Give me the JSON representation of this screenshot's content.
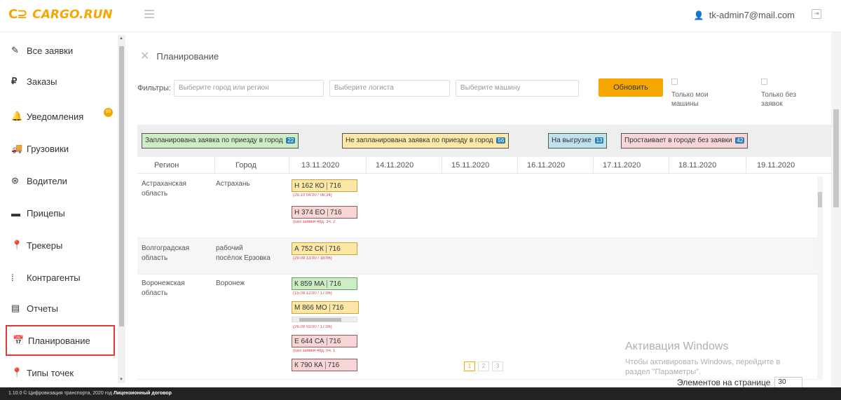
{
  "header": {
    "logo_mark": "C⊇",
    "logo_text": "CARGO.RUN",
    "user_email": "tk-admin7@mail.com"
  },
  "sidebar": {
    "items": [
      {
        "label": "Все заявки",
        "icon": "edit-icon"
      },
      {
        "label": "Заказы",
        "icon": "ruble-icon"
      },
      {
        "label": "Уведомления",
        "icon": "bell-icon",
        "badge": "99"
      },
      {
        "label": "Грузовики",
        "icon": "truck-icon"
      },
      {
        "label": "Водители",
        "icon": "steering-wheel-icon"
      },
      {
        "label": "Прицепы",
        "icon": "trailer-icon"
      },
      {
        "label": "Трекеры",
        "icon": "map-marker-icon"
      },
      {
        "label": "Контрагенты",
        "icon": "contractor-icon"
      },
      {
        "label": "Отчеты",
        "icon": "report-icon"
      },
      {
        "label": "Планирование",
        "icon": "calendar-icon",
        "active": true
      },
      {
        "label": "Типы точек",
        "icon": "map-marker-icon"
      }
    ]
  },
  "page": {
    "title": "Планирование",
    "filters_label": "Фильтры:",
    "city_placeholder": "Выберите город или регион",
    "logist_placeholder": "Выберите логиста",
    "car_placeholder": "Выберите машину",
    "update_button": "Обновить",
    "only_my_line1": "Только мои",
    "only_my_line2": "машины",
    "only_no_orders_line1": "Только без",
    "only_no_orders_line2": "заявок"
  },
  "legend": [
    {
      "label": "Запланирована заявка по приезду в город",
      "count": "22",
      "color": "#cdeec5"
    },
    {
      "label": "Не запланирована заявка по приезду в город",
      "count": "56",
      "color": "#fde8a8"
    },
    {
      "label": "На выгрузке",
      "count": "13",
      "color": "#bfe3ee"
    },
    {
      "label": "Простаивает в городе без заявки",
      "count": "42",
      "color": "#f9d6d6"
    }
  ],
  "table": {
    "headers": [
      "Регион",
      "Город",
      "13.11.2020",
      "14.11.2020",
      "15.11.2020",
      "16.11.2020",
      "17.11.2020",
      "18.11.2020",
      "19.11.2020"
    ],
    "rows": [
      {
        "region_l1": "Астраханская",
        "region_l2": "область",
        "city_l1": "Астрахань",
        "city_l2": "",
        "trucks": [
          {
            "plate": "Н 162 КО",
            "num": "716",
            "sub": "(29.10 04:00 / 06:34)",
            "color": "yellow"
          },
          {
            "plate": "Н 374 ЕО",
            "num": "716",
            "sub": "(Без заявки 48д. 3ч. 2",
            "color": "pink"
          }
        ]
      },
      {
        "region_l1": "Волгоградская",
        "region_l2": "область",
        "city_l1": "рабочий",
        "city_l2": "посёлок Ерзовка",
        "trucks": [
          {
            "plate": "А 752 СК",
            "num": "716",
            "sub": "(29.09 13:00 / 18:06)",
            "color": "yellow"
          }
        ]
      },
      {
        "region_l1": "Воронежская",
        "region_l2": "область",
        "city_l1": "Воронеж",
        "city_l2": "",
        "trucks": [
          {
            "plate": "К 859 МА",
            "num": "716",
            "sub": "(15.09 12:00 / 17:06)",
            "color": "green"
          },
          {
            "plate": "М 866 МО",
            "num": "716",
            "sub": "(26.09 03:00 / 17:06)",
            "color": "yellow"
          },
          {
            "plate": "Е 644 СА",
            "num": "716",
            "sub": "(Без заявки 48д. 5ч. 1",
            "color": "pink"
          },
          {
            "plate": "К 790 КА",
            "num": "716",
            "sub": "",
            "color": "pink"
          }
        ]
      }
    ]
  },
  "pagination": {
    "pages": [
      "1",
      "2",
      "3"
    ]
  },
  "per_page": {
    "label": "Элементов на странице",
    "value": "30"
  },
  "watermark": {
    "title": "Активация Windows",
    "line1": "Чтобы активировать Windows, перейдите в",
    "line2": "раздел \"Параметры\"."
  },
  "footer": {
    "text": "1.10.0 © Цифровизация транспорта, 2020 год",
    "link": "Лицензионный договор"
  }
}
